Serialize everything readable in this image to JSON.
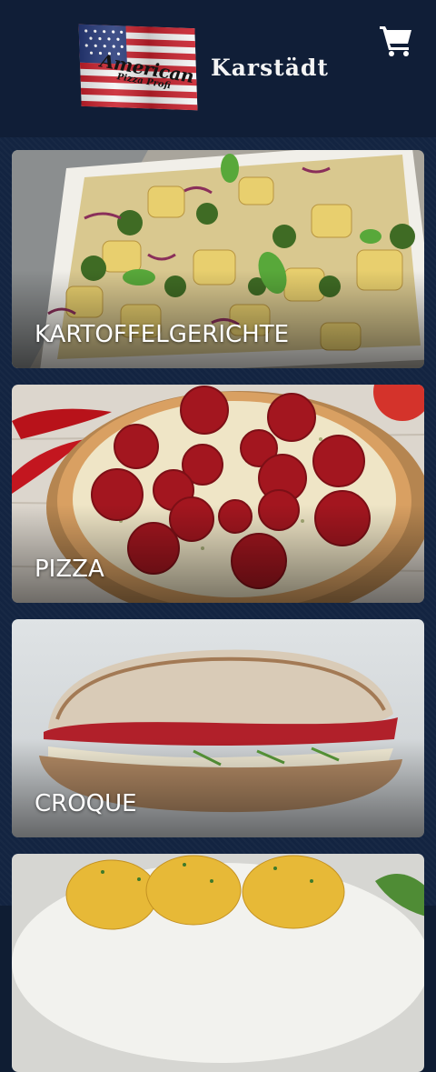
{
  "header": {
    "logo_line1": "American",
    "logo_line2": "Pizza Profi",
    "brand": "Karstädt",
    "cart_icon": "shopping-cart-icon"
  },
  "categories": [
    {
      "label": "KARTOFFELGERICHTE"
    },
    {
      "label": "PIZZA"
    },
    {
      "label": "CROQUE"
    },
    {
      "label": ""
    }
  ],
  "colors": {
    "header_bg": "#101e37",
    "page_bg": "#132441",
    "text": "#ffffff"
  }
}
